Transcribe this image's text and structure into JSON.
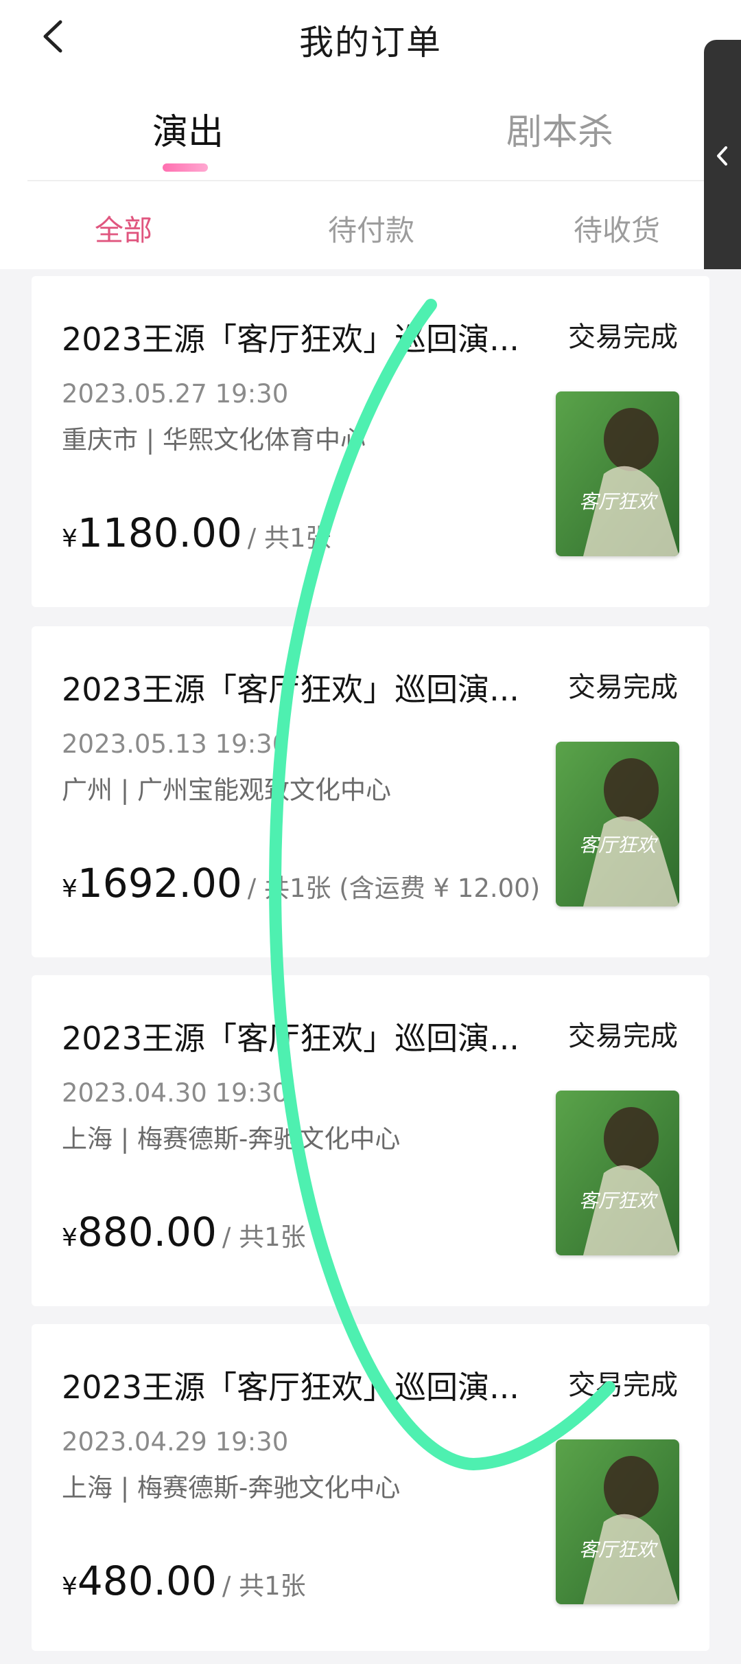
{
  "header": {
    "title": "我的订单",
    "tabs": [
      "演出",
      "剧本杀"
    ],
    "sub_tabs": [
      "全部",
      "待付款",
      "待收货"
    ]
  },
  "orders": [
    {
      "title": "2023王源「客厅狂欢」巡回演...",
      "status": "交易完成",
      "date": "2023.05.27 19:30",
      "venue": "重庆市 | 华熙文化体育中心",
      "currency": "¥",
      "amount": "1180.00",
      "quantity": "/ 共1张",
      "poster_title": "客厅狂欢"
    },
    {
      "title": "2023王源「客厅狂欢」巡回演...",
      "status": "交易完成",
      "date": "2023.05.13 19:30",
      "venue": "广州 | 广州宝能观致文化中心",
      "currency": "¥",
      "amount": "1692.00",
      "quantity": "/ 共1张 (含运费 ¥ 12.00)",
      "poster_title": "客厅狂欢"
    },
    {
      "title": "2023王源「客厅狂欢」巡回演...",
      "status": "交易完成",
      "date": "2023.04.30 19:30",
      "venue": "上海 | 梅赛德斯-奔驰文化中心",
      "currency": "¥",
      "amount": "880.00",
      "quantity": "/ 共1张",
      "poster_title": "客厅狂欢"
    },
    {
      "title": "2023王源「客厅狂欢」巡回演...",
      "status": "交易完成",
      "date": "2023.04.29 19:30",
      "venue": "上海 | 梅赛德斯-奔驰文化中心",
      "currency": "¥",
      "amount": "480.00",
      "quantity": "/ 共1张",
      "poster_title": "客厅狂欢"
    }
  ],
  "colors": {
    "accent_pink": "#e0567f",
    "tab_underline": "#ff6fb0",
    "scribble": "#4ef0b0"
  },
  "icons": {
    "back": "chevron-left-icon",
    "side_panel": "chevron-left-icon"
  }
}
